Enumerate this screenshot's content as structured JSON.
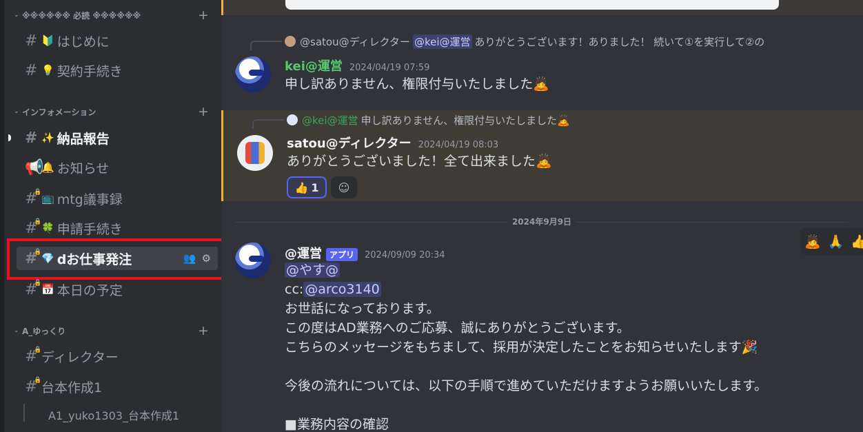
{
  "sidebar": {
    "category_required": "※※※※※※ 必読 ※※※※※※",
    "category_info": "インフォメーション",
    "category_yukkuri": "A_ゆっくり",
    "channels": {
      "hajimeni": "はじめに",
      "keiyaku": "契約手続き",
      "nouhin": "納品報告",
      "oshirase": "お知らせ",
      "mtg": "mtg議事録",
      "shinsei": "申請手続き",
      "hacchu": "dお仕事発注",
      "yotei": "本日の予定",
      "director": "ディレクター",
      "daihon": "台本作成1"
    },
    "thread": "A1_yuko1303_台本作成1"
  },
  "chat": {
    "msg1": {
      "reply_author": "@satou@ディレクター",
      "reply_mention": "@kei@運営",
      "reply_text": "ありがとうございます！ありました！ 続いて①を実行して②の",
      "author": "kei@運営",
      "timestamp": "2024/04/19 07:59",
      "text": "申し訳ありません、権限付与いたしました🙇"
    },
    "msg2": {
      "reply_mention": "@kei@運営",
      "reply_text": "申し訳ありません、権限付与いたしました🙇",
      "author": "satou@ディレクター",
      "timestamp": "2024/04/19 08:03",
      "text": "ありがとうございました！全て出来ました🙇",
      "reaction_emoji": "👍",
      "reaction_count": "1"
    },
    "date_divider": "2024年9月9日",
    "msg3": {
      "author": "@運営",
      "badge": "アプリ",
      "timestamp": "2024/09/09 20:34",
      "mention_to": "@やす@",
      "cc_label": "cc:",
      "cc_mention": "@arco3140",
      "lines": [
        "お世話になっております。",
        "この度はAD業務へのご応募、誠にありがとうございます。",
        "こちらのメッセージをもちまして、採用が決定したことをお知らせいたします🎉",
        "",
        "今後の流れについては、以下の手順で進めていただけますようお願いいたします。",
        "",
        "■業務内容の確認"
      ]
    },
    "hover_reactions": [
      "🙇",
      "🙏",
      "👍"
    ]
  }
}
